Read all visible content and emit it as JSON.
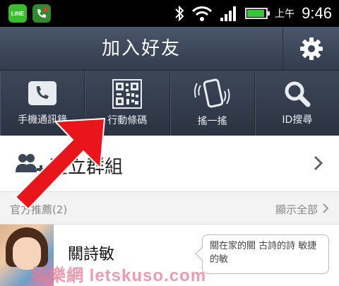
{
  "status_bar": {
    "ampm": "上午",
    "time": "9:46",
    "battery_level": 0.9,
    "icons": [
      "line-app-icon",
      "missed-call-icon",
      "bluetooth-icon",
      "wifi-icon",
      "signal-icon",
      "battery-icon"
    ],
    "line_icon_text": "LINE"
  },
  "header": {
    "title": "加入好友",
    "settings_icon": "gear-icon"
  },
  "tools": [
    {
      "label": "手機通訊錄",
      "icon": "phone-book-icon"
    },
    {
      "label": "行動條碼",
      "icon": "qr-code-icon"
    },
    {
      "label": "搖一搖",
      "icon": "shake-phone-icon"
    },
    {
      "label": "ID搜尋",
      "icon": "search-icon"
    }
  ],
  "create_group": {
    "label": "建立群組",
    "icon": "add-group-icon"
  },
  "section": {
    "title": "官方推薦(2)",
    "show_all": "顯示全部"
  },
  "friends": [
    {
      "name": "關詩敏",
      "status_message": "關在家的關 古詩的詩 敏捷的敏"
    }
  ],
  "watermark": "娛樂網 letskuso.com",
  "colors": {
    "header_bg": "#3d4758",
    "arrow": "#e8151b",
    "battery": "#36c63a"
  }
}
